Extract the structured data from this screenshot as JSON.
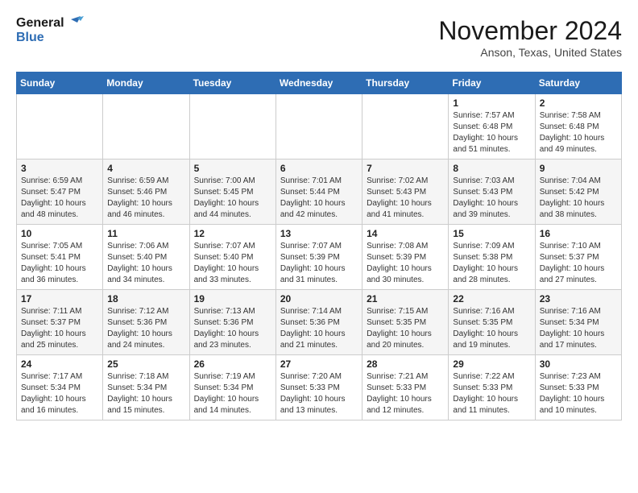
{
  "logo": {
    "line1": "General",
    "line2": "Blue"
  },
  "title": "November 2024",
  "location": "Anson, Texas, United States",
  "weekdays": [
    "Sunday",
    "Monday",
    "Tuesday",
    "Wednesday",
    "Thursday",
    "Friday",
    "Saturday"
  ],
  "weeks": [
    [
      {
        "day": "",
        "info": ""
      },
      {
        "day": "",
        "info": ""
      },
      {
        "day": "",
        "info": ""
      },
      {
        "day": "",
        "info": ""
      },
      {
        "day": "",
        "info": ""
      },
      {
        "day": "1",
        "info": "Sunrise: 7:57 AM\nSunset: 6:48 PM\nDaylight: 10 hours\nand 51 minutes."
      },
      {
        "day": "2",
        "info": "Sunrise: 7:58 AM\nSunset: 6:48 PM\nDaylight: 10 hours\nand 49 minutes."
      }
    ],
    [
      {
        "day": "3",
        "info": "Sunrise: 6:59 AM\nSunset: 5:47 PM\nDaylight: 10 hours\nand 48 minutes."
      },
      {
        "day": "4",
        "info": "Sunrise: 6:59 AM\nSunset: 5:46 PM\nDaylight: 10 hours\nand 46 minutes."
      },
      {
        "day": "5",
        "info": "Sunrise: 7:00 AM\nSunset: 5:45 PM\nDaylight: 10 hours\nand 44 minutes."
      },
      {
        "day": "6",
        "info": "Sunrise: 7:01 AM\nSunset: 5:44 PM\nDaylight: 10 hours\nand 42 minutes."
      },
      {
        "day": "7",
        "info": "Sunrise: 7:02 AM\nSunset: 5:43 PM\nDaylight: 10 hours\nand 41 minutes."
      },
      {
        "day": "8",
        "info": "Sunrise: 7:03 AM\nSunset: 5:43 PM\nDaylight: 10 hours\nand 39 minutes."
      },
      {
        "day": "9",
        "info": "Sunrise: 7:04 AM\nSunset: 5:42 PM\nDaylight: 10 hours\nand 38 minutes."
      }
    ],
    [
      {
        "day": "10",
        "info": "Sunrise: 7:05 AM\nSunset: 5:41 PM\nDaylight: 10 hours\nand 36 minutes."
      },
      {
        "day": "11",
        "info": "Sunrise: 7:06 AM\nSunset: 5:40 PM\nDaylight: 10 hours\nand 34 minutes."
      },
      {
        "day": "12",
        "info": "Sunrise: 7:07 AM\nSunset: 5:40 PM\nDaylight: 10 hours\nand 33 minutes."
      },
      {
        "day": "13",
        "info": "Sunrise: 7:07 AM\nSunset: 5:39 PM\nDaylight: 10 hours\nand 31 minutes."
      },
      {
        "day": "14",
        "info": "Sunrise: 7:08 AM\nSunset: 5:39 PM\nDaylight: 10 hours\nand 30 minutes."
      },
      {
        "day": "15",
        "info": "Sunrise: 7:09 AM\nSunset: 5:38 PM\nDaylight: 10 hours\nand 28 minutes."
      },
      {
        "day": "16",
        "info": "Sunrise: 7:10 AM\nSunset: 5:37 PM\nDaylight: 10 hours\nand 27 minutes."
      }
    ],
    [
      {
        "day": "17",
        "info": "Sunrise: 7:11 AM\nSunset: 5:37 PM\nDaylight: 10 hours\nand 25 minutes."
      },
      {
        "day": "18",
        "info": "Sunrise: 7:12 AM\nSunset: 5:36 PM\nDaylight: 10 hours\nand 24 minutes."
      },
      {
        "day": "19",
        "info": "Sunrise: 7:13 AM\nSunset: 5:36 PM\nDaylight: 10 hours\nand 23 minutes."
      },
      {
        "day": "20",
        "info": "Sunrise: 7:14 AM\nSunset: 5:36 PM\nDaylight: 10 hours\nand 21 minutes."
      },
      {
        "day": "21",
        "info": "Sunrise: 7:15 AM\nSunset: 5:35 PM\nDaylight: 10 hours\nand 20 minutes."
      },
      {
        "day": "22",
        "info": "Sunrise: 7:16 AM\nSunset: 5:35 PM\nDaylight: 10 hours\nand 19 minutes."
      },
      {
        "day": "23",
        "info": "Sunrise: 7:16 AM\nSunset: 5:34 PM\nDaylight: 10 hours\nand 17 minutes."
      }
    ],
    [
      {
        "day": "24",
        "info": "Sunrise: 7:17 AM\nSunset: 5:34 PM\nDaylight: 10 hours\nand 16 minutes."
      },
      {
        "day": "25",
        "info": "Sunrise: 7:18 AM\nSunset: 5:34 PM\nDaylight: 10 hours\nand 15 minutes."
      },
      {
        "day": "26",
        "info": "Sunrise: 7:19 AM\nSunset: 5:34 PM\nDaylight: 10 hours\nand 14 minutes."
      },
      {
        "day": "27",
        "info": "Sunrise: 7:20 AM\nSunset: 5:33 PM\nDaylight: 10 hours\nand 13 minutes."
      },
      {
        "day": "28",
        "info": "Sunrise: 7:21 AM\nSunset: 5:33 PM\nDaylight: 10 hours\nand 12 minutes."
      },
      {
        "day": "29",
        "info": "Sunrise: 7:22 AM\nSunset: 5:33 PM\nDaylight: 10 hours\nand 11 minutes."
      },
      {
        "day": "30",
        "info": "Sunrise: 7:23 AM\nSunset: 5:33 PM\nDaylight: 10 hours\nand 10 minutes."
      }
    ]
  ]
}
